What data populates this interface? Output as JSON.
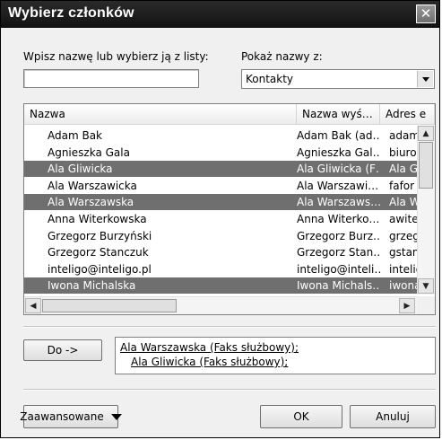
{
  "window": {
    "title": "Wybierz członków"
  },
  "search": {
    "label": "Wpisz nazwę lub wybierz ją z listy:",
    "value": ""
  },
  "address_book": {
    "label": "Pokaż nazwy z:",
    "selected": "Kontakty"
  },
  "columns": [
    "Nazwa",
    "Nazwa wyś…",
    "Adres e"
  ],
  "rows": [
    {
      "name": "Adam Bak",
      "display": "Adam Bak (ad…",
      "addr": "adam",
      "selected": false
    },
    {
      "name": "Agnieszka Gala",
      "display": "Agnieszka Gal…",
      "addr": "biuro",
      "selected": false
    },
    {
      "name": "Ala Gliwicka",
      "display": "Ala Gliwicka (F…",
      "addr": "Ala G",
      "selected": true
    },
    {
      "name": "Ala Warszawicka",
      "display": "Ala Warszawi…",
      "addr": "fafor",
      "selected": false
    },
    {
      "name": "Ala Warszawska",
      "display": "Ala Warszaws…",
      "addr": "Ala W",
      "selected": true
    },
    {
      "name": "Anna Witerkowska",
      "display": "Anna Witerko…",
      "addr": "awite",
      "selected": false
    },
    {
      "name": "Grzegorz Burzyński",
      "display": "Grzegorz Burz…",
      "addr": "grzeg",
      "selected": false
    },
    {
      "name": "Grzegorz Stanczuk",
      "display": "Grzegorz Stan…",
      "addr": "gstan",
      "selected": false
    },
    {
      "name": "inteligo@inteligo.pl",
      "display": "inteligo@inteli…",
      "addr": "intelig",
      "selected": false
    },
    {
      "name": "Iwona Michalska",
      "display": "Iwona Michals…",
      "addr": "iwona",
      "selected": true
    }
  ],
  "to_button": {
    "label": "Do ->"
  },
  "recipients": [
    "Ala Warszawska (Faks służbowy);",
    "Ala Gliwicka (Faks służbowy);"
  ],
  "buttons": {
    "advanced": "Zaawansowane",
    "ok": "OK",
    "cancel": "Anuluj"
  },
  "icons": {
    "close": "close-icon",
    "dropdown": "chevron-down-icon"
  },
  "colors": {
    "titlebar": "#1c1c1c",
    "selection": "#6f6f6f"
  }
}
